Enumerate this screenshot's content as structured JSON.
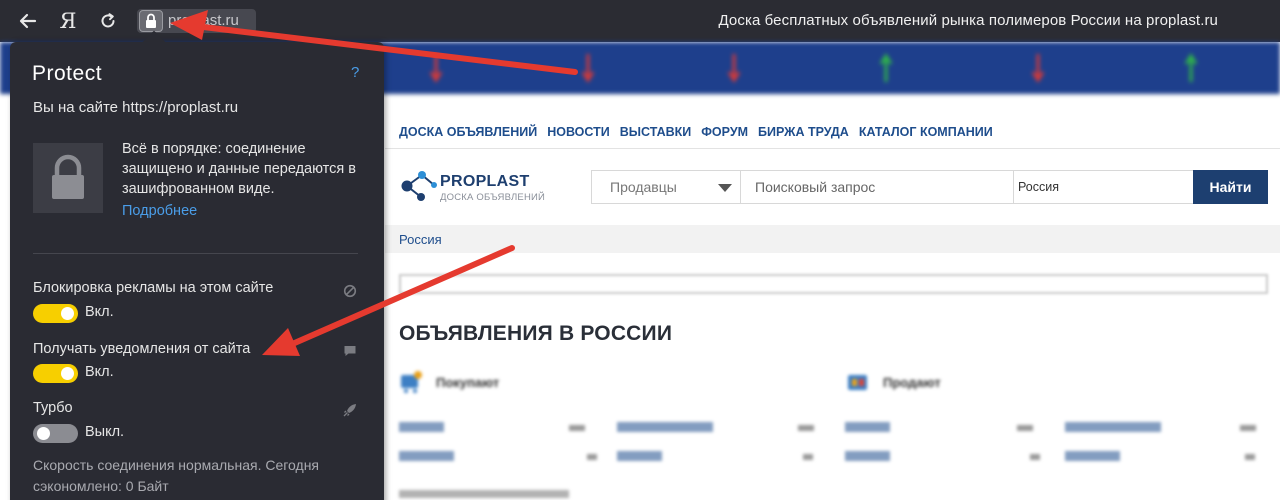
{
  "browser": {
    "back_icon": "arrow-left-icon",
    "yandex_label": "Я",
    "reload_icon": "reload-icon",
    "url": "proplast.ru",
    "window_title": "Доска бесплатных объявлений рынка полимеров России на proplast.ru"
  },
  "protect": {
    "title": "Protect",
    "help": "?",
    "site_line": "Вы на сайте https://proplast.ru",
    "status_text": "Всё в порядке: соединение защищено и данные передаются в зашифрованном виде.",
    "more_link": "Подробнее",
    "ad_block": {
      "label": "Блокировка рекламы на этом сайте",
      "state": "Вкл.",
      "on": true
    },
    "notifications": {
      "label": "Получать уведомления от сайта",
      "state": "Вкл.",
      "on": true
    },
    "turbo": {
      "label": "Турбо",
      "state": "Выкл.",
      "on": false
    },
    "speed_note": "Скорость соединения нормальная. Сегодня сэкономлено: 0 Байт"
  },
  "site": {
    "menu": [
      "ДОСКА ОБЪЯВЛЕНИЙ",
      "НОВОСТИ",
      "ВЫСТАВКИ",
      "ФОРУМ",
      "БИРЖА ТРУДА",
      "КАТАЛОГ КОМПАНИИ"
    ],
    "logo_title": "PROPLAST",
    "logo_subtitle": "ДОСКА ОБЪЯВЛЕНИЙ",
    "search": {
      "category": "Продавцы",
      "placeholder": "Поисковый запрос",
      "region": "Россия",
      "button": "Найти"
    },
    "breadcrumb": "Россия",
    "heading": "ОБЪЯВЛЕНИЯ В РОССИИ",
    "buyers": "Покупают",
    "sellers": "Продают"
  },
  "colors": {
    "panel_bg": "#2a2b33",
    "toggle_on": "#f7cf00",
    "link_blue": "#4a9de8",
    "site_blue": "#1e4d8c",
    "ticker_bg": "#1e3f8c",
    "arrow_red": "#e53a2f"
  }
}
